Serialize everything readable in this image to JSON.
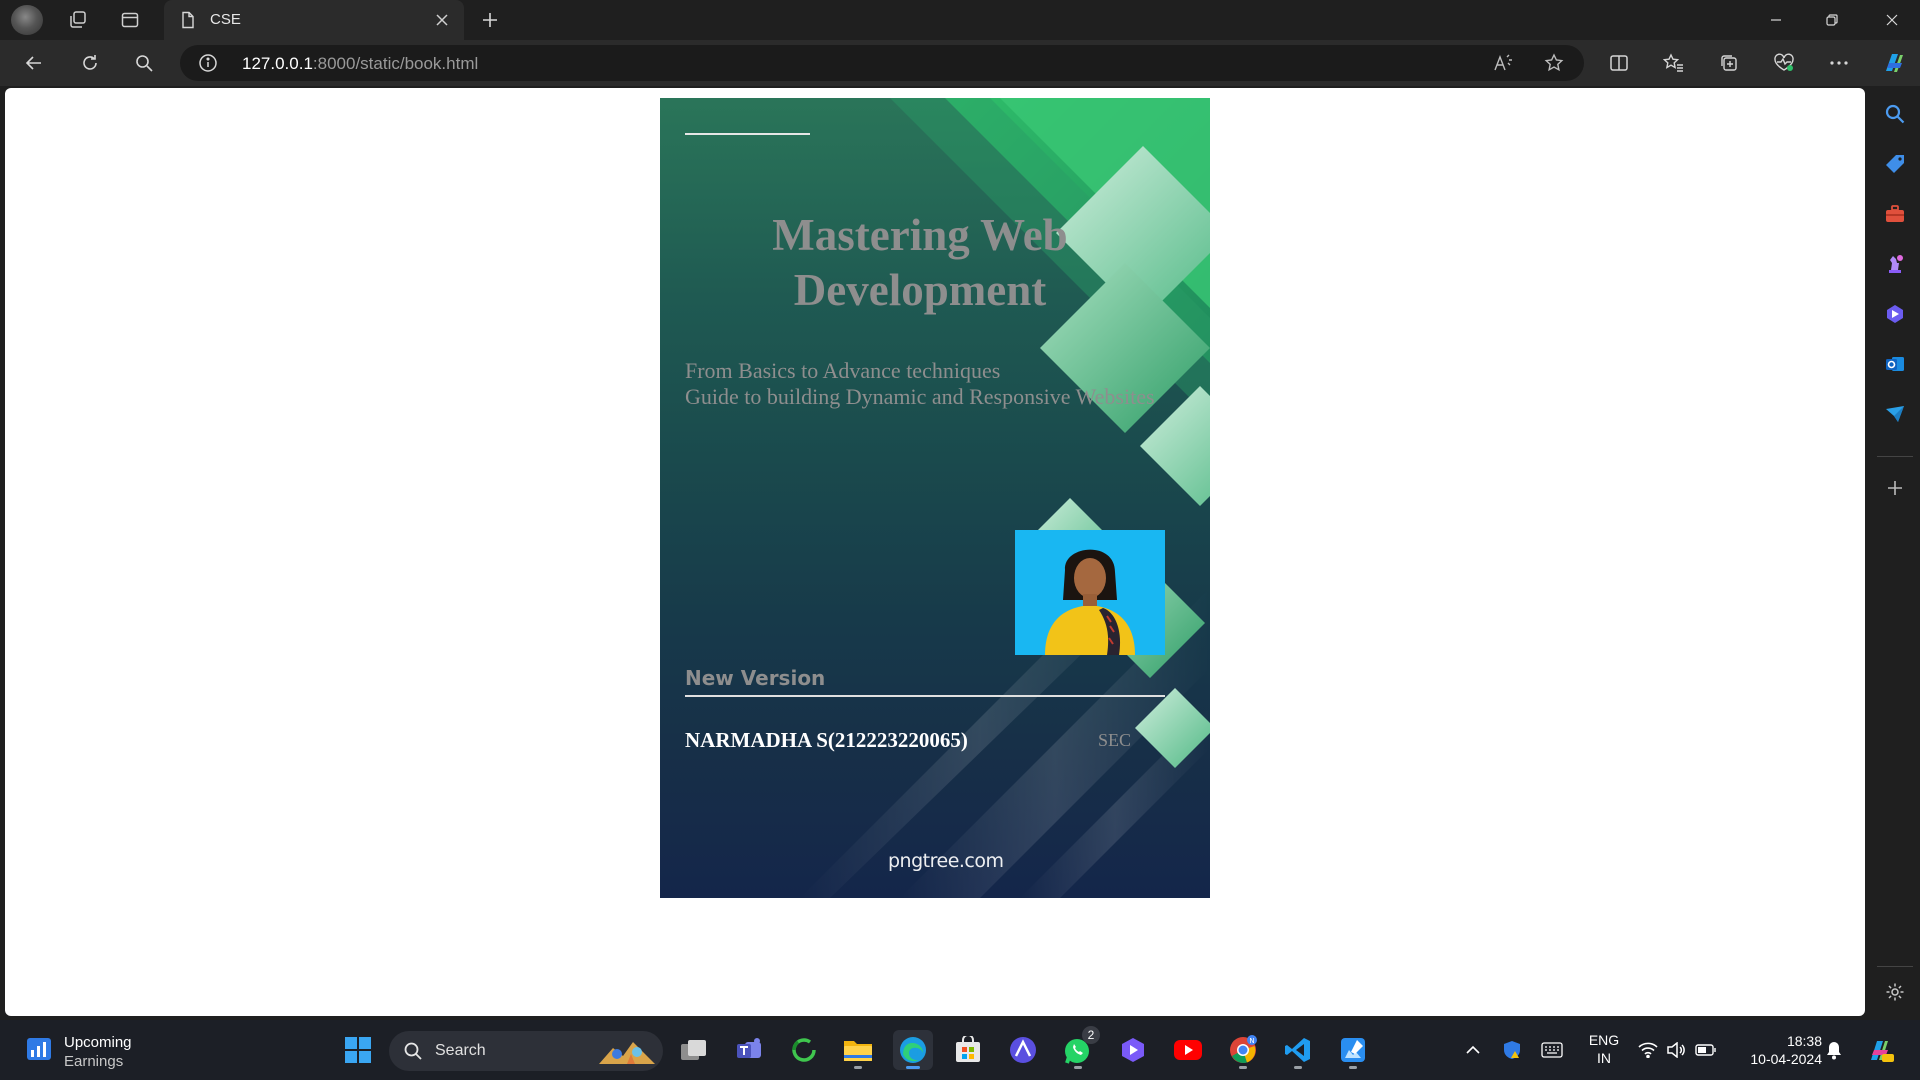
{
  "browser": {
    "tab_title": "CSE",
    "url_host": "127.0.0.1",
    "url_rest": ":8000/static/book.html"
  },
  "cover": {
    "title_line1": "Mastering Web",
    "title_line2": "Development",
    "subtitle_line1": "From Basics to Advance techniques",
    "subtitle_line2": "Guide to building Dynamic and Responsive Websites",
    "badge": "New Version",
    "author": "NARMADHA S(212223220065)",
    "section": "SEC",
    "watermark": "pngtree.com"
  },
  "taskbar": {
    "widget_line1": "Upcoming",
    "widget_line2": "Earnings",
    "search_label": "Search",
    "whatsapp_badge": "2",
    "lang_line1": "ENG",
    "lang_line2": "IN",
    "time": "18:38",
    "date": "10-04-2024"
  },
  "colors": {
    "accent_green": "#2fbf6a",
    "cover_dark": "#14264a",
    "photo_bg": "#19b7f2"
  }
}
